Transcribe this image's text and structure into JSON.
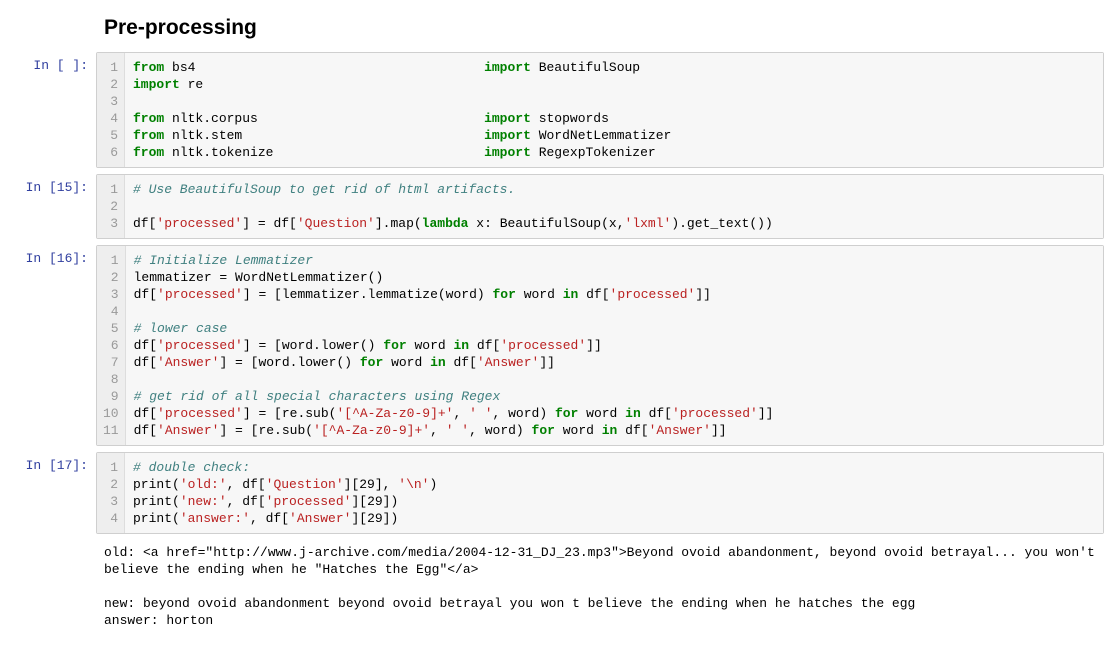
{
  "heading": "Pre-processing",
  "cells": [
    {
      "prompt": "In [ ]:",
      "type": "code",
      "lines": [
        [
          {
            "t": "from",
            "c": "kw"
          },
          {
            "t": " bs4                                     "
          },
          {
            "t": "import",
            "c": "kw"
          },
          {
            "t": " BeautifulSoup"
          }
        ],
        [
          {
            "t": "import",
            "c": "kw"
          },
          {
            "t": " re"
          }
        ],
        [
          {
            "t": ""
          }
        ],
        [
          {
            "t": "from",
            "c": "kw"
          },
          {
            "t": " nltk.corpus                             "
          },
          {
            "t": "import",
            "c": "kw"
          },
          {
            "t": " stopwords"
          }
        ],
        [
          {
            "t": "from",
            "c": "kw"
          },
          {
            "t": " nltk.stem                               "
          },
          {
            "t": "import",
            "c": "kw"
          },
          {
            "t": " WordNetLemmatizer"
          }
        ],
        [
          {
            "t": "from",
            "c": "kw"
          },
          {
            "t": " nltk.tokenize                           "
          },
          {
            "t": "import",
            "c": "kw"
          },
          {
            "t": " RegexpTokenizer"
          }
        ]
      ]
    },
    {
      "prompt": "In [15]:",
      "type": "code",
      "lines": [
        [
          {
            "t": "# Use BeautifulSoup to get rid of html artifacts.",
            "c": "cm"
          }
        ],
        [
          {
            "t": ""
          }
        ],
        [
          {
            "t": "df["
          },
          {
            "t": "'processed'",
            "c": "st"
          },
          {
            "t": "] = df["
          },
          {
            "t": "'Question'",
            "c": "st"
          },
          {
            "t": "].map("
          },
          {
            "t": "lambda",
            "c": "kw"
          },
          {
            "t": " x: BeautifulSoup(x,"
          },
          {
            "t": "'lxml'",
            "c": "st"
          },
          {
            "t": ").get_text())"
          }
        ]
      ]
    },
    {
      "prompt": "In [16]:",
      "type": "code",
      "lines": [
        [
          {
            "t": "# Initialize Lemmatizer",
            "c": "cm"
          }
        ],
        [
          {
            "t": "lemmatizer = WordNetLemmatizer()"
          }
        ],
        [
          {
            "t": "df["
          },
          {
            "t": "'processed'",
            "c": "st"
          },
          {
            "t": "] = [lemmatizer.lemmatize(word) "
          },
          {
            "t": "for",
            "c": "kw"
          },
          {
            "t": " word "
          },
          {
            "t": "in",
            "c": "kw"
          },
          {
            "t": " df["
          },
          {
            "t": "'processed'",
            "c": "st"
          },
          {
            "t": "]]"
          }
        ],
        [
          {
            "t": ""
          }
        ],
        [
          {
            "t": "# lower case",
            "c": "cm"
          }
        ],
        [
          {
            "t": "df["
          },
          {
            "t": "'processed'",
            "c": "st"
          },
          {
            "t": "] = [word.lower() "
          },
          {
            "t": "for",
            "c": "kw"
          },
          {
            "t": " word "
          },
          {
            "t": "in",
            "c": "kw"
          },
          {
            "t": " df["
          },
          {
            "t": "'processed'",
            "c": "st"
          },
          {
            "t": "]]"
          }
        ],
        [
          {
            "t": "df["
          },
          {
            "t": "'Answer'",
            "c": "st"
          },
          {
            "t": "] = [word.lower() "
          },
          {
            "t": "for",
            "c": "kw"
          },
          {
            "t": " word "
          },
          {
            "t": "in",
            "c": "kw"
          },
          {
            "t": " df["
          },
          {
            "t": "'Answer'",
            "c": "st"
          },
          {
            "t": "]]"
          }
        ],
        [
          {
            "t": ""
          }
        ],
        [
          {
            "t": "# get rid of all special characters using Regex",
            "c": "cm"
          }
        ],
        [
          {
            "t": "df["
          },
          {
            "t": "'processed'",
            "c": "st"
          },
          {
            "t": "] = [re.sub("
          },
          {
            "t": "'[^A-Za-z0-9]+'",
            "c": "st"
          },
          {
            "t": ", "
          },
          {
            "t": "' '",
            "c": "st"
          },
          {
            "t": ", word) "
          },
          {
            "t": "for",
            "c": "kw"
          },
          {
            "t": " word "
          },
          {
            "t": "in",
            "c": "kw"
          },
          {
            "t": " df["
          },
          {
            "t": "'processed'",
            "c": "st"
          },
          {
            "t": "]]"
          }
        ],
        [
          {
            "t": "df["
          },
          {
            "t": "'Answer'",
            "c": "st"
          },
          {
            "t": "] = [re.sub("
          },
          {
            "t": "'[^A-Za-z0-9]+'",
            "c": "st"
          },
          {
            "t": ", "
          },
          {
            "t": "' '",
            "c": "st"
          },
          {
            "t": ", word) "
          },
          {
            "t": "for",
            "c": "kw"
          },
          {
            "t": " word "
          },
          {
            "t": "in",
            "c": "kw"
          },
          {
            "t": " df["
          },
          {
            "t": "'Answer'",
            "c": "st"
          },
          {
            "t": "]]"
          }
        ]
      ]
    },
    {
      "prompt": "In [17]:",
      "type": "code",
      "lines": [
        [
          {
            "t": "# double check:",
            "c": "cm"
          }
        ],
        [
          {
            "t": "print("
          },
          {
            "t": "'old:'",
            "c": "st"
          },
          {
            "t": ", df["
          },
          {
            "t": "'Question'",
            "c": "st"
          },
          {
            "t": "][29], "
          },
          {
            "t": "'\\n'",
            "c": "st"
          },
          {
            "t": ")"
          }
        ],
        [
          {
            "t": "print("
          },
          {
            "t": "'new:'",
            "c": "st"
          },
          {
            "t": ", df["
          },
          {
            "t": "'processed'",
            "c": "st"
          },
          {
            "t": "][29])"
          }
        ],
        [
          {
            "t": "print("
          },
          {
            "t": "'answer:'",
            "c": "st"
          },
          {
            "t": ", df["
          },
          {
            "t": "'Answer'",
            "c": "st"
          },
          {
            "t": "][29])"
          }
        ]
      ]
    },
    {
      "prompt": "",
      "type": "output",
      "text": "old: <a href=\"http://www.j-archive.com/media/2004-12-31_DJ_23.mp3\">Beyond ovoid abandonment, beyond ovoid betrayal... you won't believe the ending when he \"Hatches the Egg\"</a> \n\nnew: beyond ovoid abandonment beyond ovoid betrayal you won t believe the ending when he hatches the egg\nanswer: horton"
    }
  ]
}
